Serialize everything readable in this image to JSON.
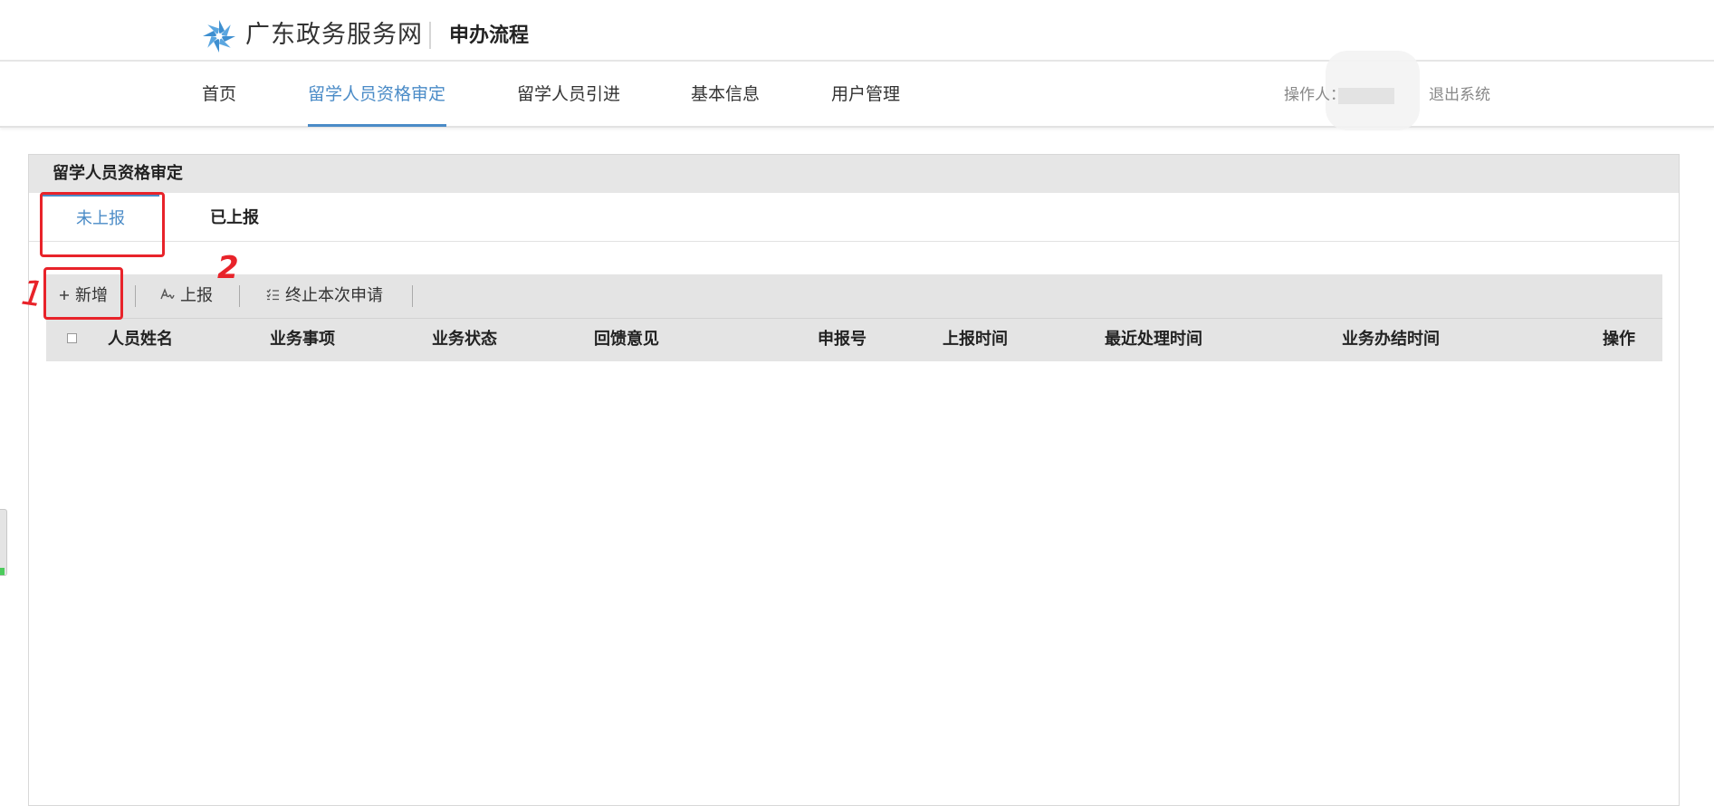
{
  "header": {
    "site_name": "广东政务服务网",
    "page_heading": "申办流程",
    "brand_color": "#3e8fd0"
  },
  "nav": {
    "items": [
      {
        "label": "首页"
      },
      {
        "label": "留学人员资格审定",
        "active": true
      },
      {
        "label": "留学人员引进"
      },
      {
        "label": "基本信息"
      },
      {
        "label": "用户管理"
      }
    ],
    "operator_label": "操作人：",
    "logout_label": "退出系统",
    "accent_color": "#4a8bc7"
  },
  "panel": {
    "title": "留学人员资格审定",
    "tabs": [
      {
        "label": "未上报",
        "active": true
      },
      {
        "label": "已上报"
      }
    ],
    "toolbar": {
      "add_label": "新增",
      "report_label": "上报",
      "terminate_label": "终止本次申请",
      "add_icon": "plus-icon",
      "report_icon": "report-icon",
      "terminate_icon": "list-check-icon"
    },
    "table": {
      "columns": [
        "人员姓名",
        "业务事项",
        "业务状态",
        "回馈意见",
        "申报号",
        "上报时间",
        "最近处理时间",
        "业务办结时间",
        "操作"
      ],
      "rows": []
    }
  },
  "annotations": {
    "step_1": "1",
    "step_2": "2",
    "color": "#e8232a"
  }
}
